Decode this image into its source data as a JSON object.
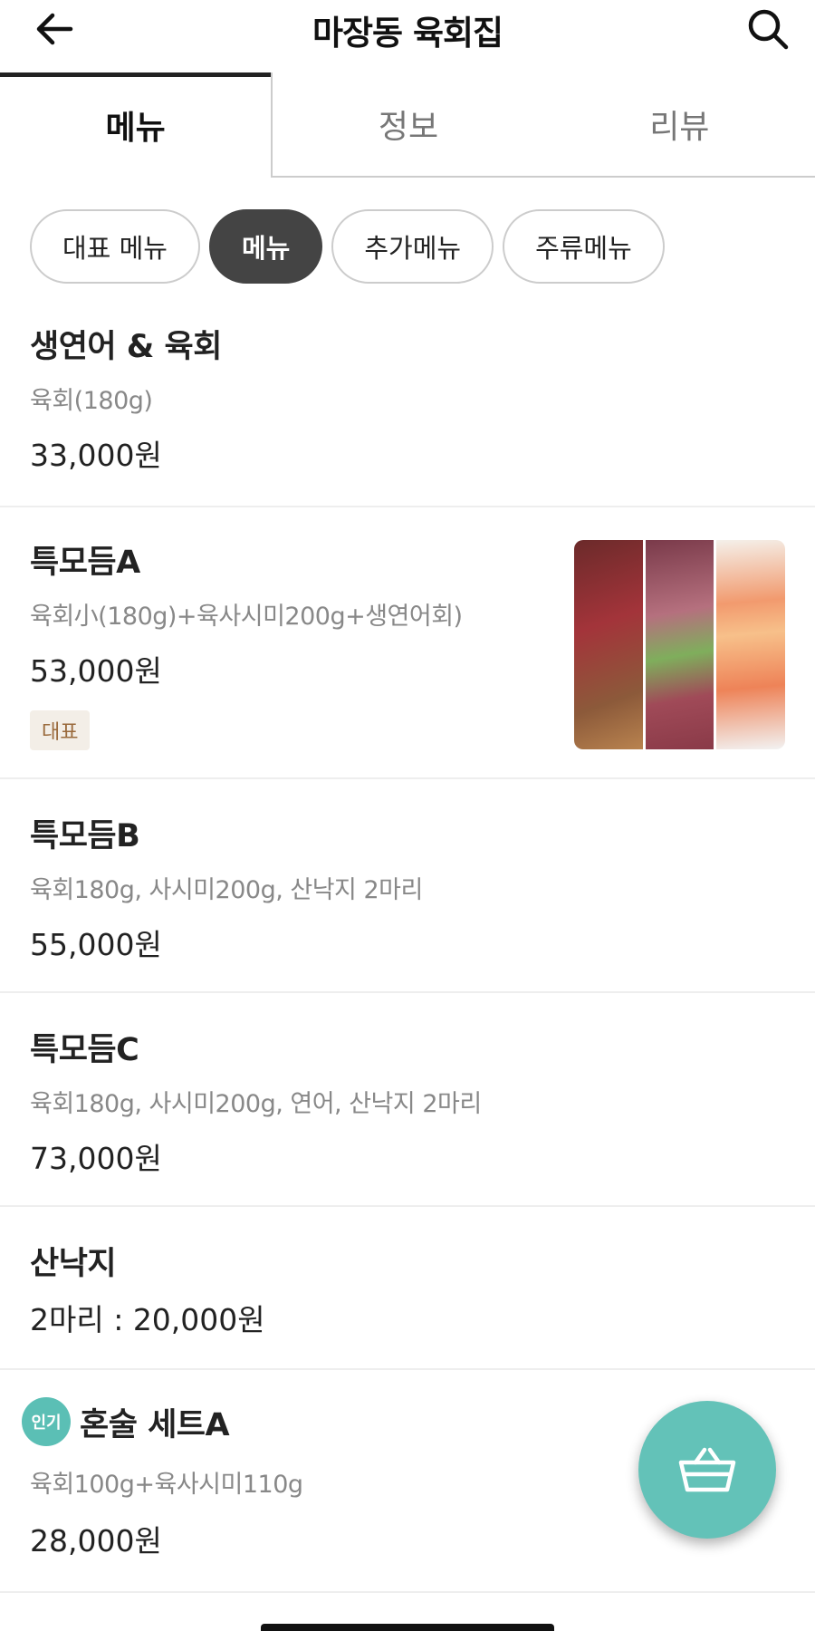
{
  "header": {
    "title": "마장동 육회집",
    "back_icon": "arrow-left-icon",
    "search_icon": "search-icon"
  },
  "tabs": [
    {
      "label": "메뉴",
      "active": true
    },
    {
      "label": "정보",
      "active": false
    },
    {
      "label": "리뷰",
      "active": false
    }
  ],
  "chips": [
    {
      "label": "대표 메뉴",
      "active": false
    },
    {
      "label": "메뉴",
      "active": true
    },
    {
      "label": "추가메뉴",
      "active": false
    },
    {
      "label": "주류메뉴",
      "active": false
    }
  ],
  "menu": [
    {
      "name": "생연어 & 육회",
      "desc": "육회(180g)",
      "price": "33,000원"
    },
    {
      "name": "특모듬A",
      "desc": "육회小(180g)+육사시미200g+생연어회)",
      "price": "53,000원",
      "badge": "대표"
    },
    {
      "name": "특모듬B",
      "desc": "육회180g, 사시미200g, 산낙지 2마리",
      "price": "55,000원"
    },
    {
      "name": "특모듬C",
      "desc": "육회180g, 사시미200g, 연어, 산낙지 2마리",
      "price": "73,000원"
    },
    {
      "name": "산낙지",
      "price": "2마리 : 20,000원"
    },
    {
      "name": "혼술 세트A",
      "desc": "육회100g+육사시미110g",
      "price": "28,000원",
      "tag": "인기"
    }
  ],
  "colors": {
    "accent": "#63c2b8",
    "chip_active": "#444444",
    "badge_bg": "#f3eee7",
    "badge_text": "#9a6a3c"
  },
  "fab_icon": "cart-basket-icon"
}
